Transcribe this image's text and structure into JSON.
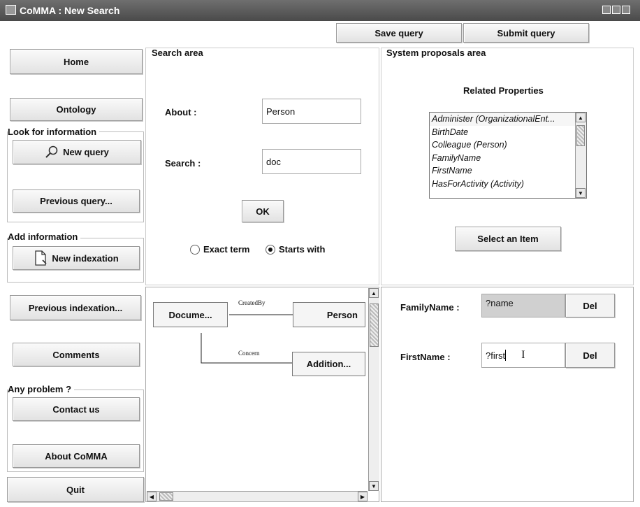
{
  "window": {
    "title": "CoMMA : New Search"
  },
  "toolbar": {
    "save_label": "Save query",
    "submit_label": "Submit query"
  },
  "sidebar": {
    "home": "Home",
    "ontology": "Ontology",
    "look_title": "Look for information",
    "new_query": "New query",
    "previous_query": "Previous query...",
    "add_title": "Add information",
    "new_indexation": "New indexation",
    "previous_indexation": "Previous indexation...",
    "comments": "Comments",
    "problem_title": "Any problem ?",
    "contact": "Contact us",
    "about": "About CoMMA",
    "quit": "Quit"
  },
  "search": {
    "title": "Search area",
    "about_label": "About :",
    "about_value": "Person",
    "search_label": "Search :",
    "search_value": "doc",
    "ok_label": "OK",
    "exact_label": "Exact term",
    "starts_label": "Starts with",
    "selected_mode": "starts"
  },
  "proposals": {
    "title": "System proposals area",
    "related_title": "Related Properties",
    "items": [
      "Administer (OrganizationalEnt...",
      "BirthDate",
      "Colleague (Person)",
      "FamilyName",
      "FirstName",
      "HasForActivity (Activity)"
    ],
    "select_label": "Select an Item"
  },
  "graph": {
    "node_document": "Docume...",
    "node_person": "Person",
    "node_addition": "Addition...",
    "edge_createdby": "CreatedBy",
    "edge_concern": "Concern"
  },
  "properties": {
    "family_label": "FamilyName :",
    "family_value": "?name",
    "first_label": "FirstName :",
    "first_value": "?first",
    "del_label": "Del"
  },
  "colors": {
    "titlebar": "#555555",
    "selection": "#d0d0d0"
  }
}
